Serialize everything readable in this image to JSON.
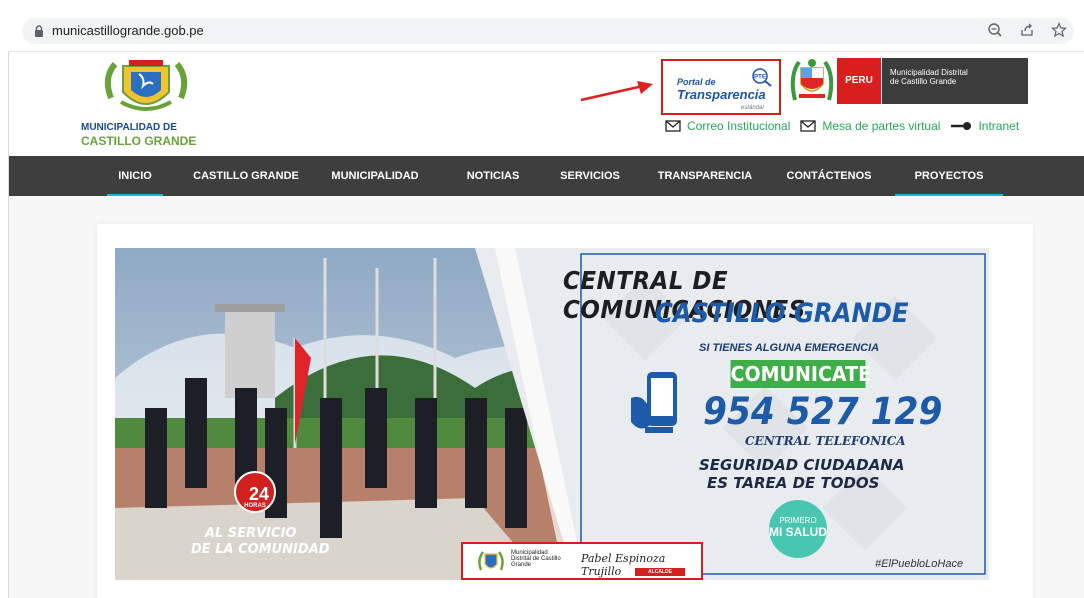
{
  "browser": {
    "url": "municastillogrande.gob.pe",
    "icons": [
      "zoom-icon",
      "share-icon",
      "star-icon"
    ]
  },
  "header": {
    "logo": {
      "line1": "MUNICIPALIDAD DE",
      "line2": "CASTILLO GRANDE"
    },
    "transparency": {
      "line1": "Portal de",
      "line2": "Transparencia",
      "line3": "estándar",
      "badge": "PTE"
    },
    "peru_label": "PERU",
    "muni_label": {
      "line1": "Municipalidad Distrital",
      "line2": "de Castillo Grande"
    },
    "links": [
      {
        "icon": "mail-icon",
        "label": "Correo Institucional"
      },
      {
        "icon": "mail-icon",
        "label": "Mesa de partes virtual"
      },
      {
        "icon": "key-icon",
        "label": "Intranet"
      }
    ]
  },
  "nav": {
    "items": [
      {
        "label": "INICIO",
        "active": true
      },
      {
        "label": "CASTILLO GRANDE",
        "active": false
      },
      {
        "label": "MUNICIPALIDAD",
        "active": false
      },
      {
        "label": "NOTICIAS",
        "active": false
      },
      {
        "label": "SERVICIOS",
        "active": false
      },
      {
        "label": "TRANSPARENCIA",
        "active": false
      },
      {
        "label": "CONTÁCTENOS",
        "active": false
      },
      {
        "label": "PROYECTOS",
        "active": true
      }
    ]
  },
  "banner": {
    "title1": "CENTRAL DE COMUNICACIONES",
    "title2": "CASTILLO GRANDE",
    "emergency": "SI TIENES ALGUNA EMERGENCIA",
    "comunicate": "COMUNICATE",
    "phone": "954 527 129",
    "central": "CENTRAL TELEFONICA",
    "seguridad1": "SEGURIDAD CIUDADANA",
    "seguridad2": "ES TAREA DE TODOS",
    "hashtag": "#ElPuebloLoHace",
    "salud": {
      "line1": "PRIMERO",
      "line2": "MI SALUD"
    },
    "hours_num": "24",
    "hours_label": "HORAS",
    "servicio1": "AL SERVICIO",
    "servicio2": "DE LA COMUNIDAD",
    "footer": {
      "muni": "Municipalidad Distrital de Castillo Grande",
      "alcalde": "Pabel Espinoza Trujillo",
      "tag": "ALCALDE"
    }
  },
  "colors": {
    "nav_bg": "#3e3e3e",
    "accent_green": "#2aa65b",
    "accent_blue": "#1d5aa8",
    "accent_red": "#d2201f",
    "nav_active": "#1fb6d6"
  }
}
